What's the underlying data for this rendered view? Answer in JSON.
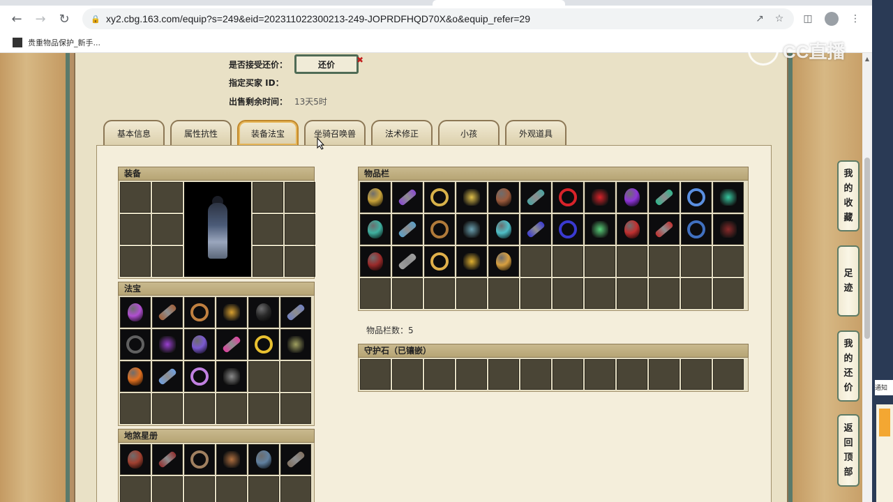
{
  "browser": {
    "url": "xy2.cbg.163.com/equip?s=249&eid=202311022300213-249-JOPRDFHQD70X&o&equip_refer=29",
    "bookmark_label": "贵重物品保护_新手..."
  },
  "watermark": {
    "text": "CC直播"
  },
  "info": {
    "counter_offer_label": "是否接受还价：",
    "counter_offer_button": "还价",
    "buyer_id_label": "指定买家 ID：",
    "time_left_label": "出售剩余时间：",
    "time_left_value": "13天5时"
  },
  "tabs": [
    {
      "label": "基本信息",
      "active": false
    },
    {
      "label": "属性抗性",
      "active": false
    },
    {
      "label": "装备法宝",
      "active": true
    },
    {
      "label": "坐骑召唤兽",
      "active": false
    },
    {
      "label": "法术修正",
      "active": false
    },
    {
      "label": "小孩",
      "active": false
    },
    {
      "label": "外观道具",
      "active": false
    }
  ],
  "equip": {
    "title": "装备"
  },
  "fabao": {
    "title": "法宝",
    "filled": 16,
    "total": 24
  },
  "stars": {
    "title": "地煞星册",
    "filled": 6,
    "total": 12
  },
  "inventory": {
    "title": "物品栏",
    "filled": 29,
    "total": 48,
    "count_label": "物品栏数：5"
  },
  "guard": {
    "title": "守护石（已镶嵌）",
    "total": 12
  },
  "sidenav": {
    "favorites": [
      "我",
      "的",
      "收",
      "藏"
    ],
    "footprints": [
      "足",
      "迹"
    ],
    "my_offers": [
      "我",
      "的",
      "还",
      "价"
    ],
    "back_top": [
      "返",
      "回",
      "顶",
      "部"
    ]
  },
  "outside": {
    "notice": "通知"
  },
  "colors": {
    "item_palette": [
      "#c9a33a",
      "#8a4bd0",
      "#d8b24a",
      "#e0c04a",
      "#9b5a3c",
      "#4aa3a0",
      "#d8232a",
      "#d8232a",
      "#8e35d8",
      "#2fb58c",
      "#5a8fe0",
      "#37c7a0",
      "#3fb0a0",
      "#5aa0c8",
      "#b07a3a",
      "#6aa0b0",
      "#4fc0c8",
      "#3a3ad0",
      "#3a3ad0",
      "#5ad07a",
      "#c03030",
      "#c03030",
      "#4070c0",
      "#8a2a2a",
      "#9a2a2a",
      "#a0a0a0",
      "#e0b04a",
      "#e0b030",
      "#d8a040"
    ],
    "fabao_palette": [
      "#b04fd0",
      "#a0603a",
      "#c08040",
      "#d8a030",
      "#2a2a2a",
      "#7080c0",
      "#606060",
      "#9a40d0",
      "#7b5ad0",
      "#e040a0",
      "#e8c030",
      "#a0a060",
      "#e07020",
      "#70a0e0",
      "#c080e0",
      "#8a8a8a"
    ],
    "star_palette": [
      "#a04030",
      "#903030",
      "#a08060",
      "#b07040",
      "#6080a0",
      "#807060"
    ]
  }
}
